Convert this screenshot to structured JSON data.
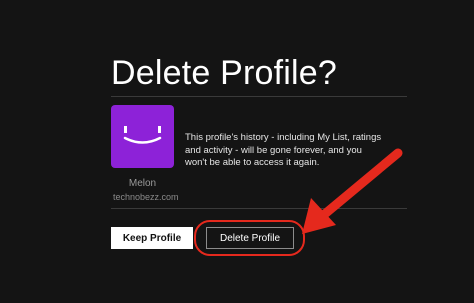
{
  "dialog": {
    "title": "Delete Profile?",
    "message": "This profile's history - including My List, ratings and activity - will be gone forever, and you won't be able to access it again.",
    "profile_name": "Melon"
  },
  "watermark": "technobezz.com",
  "buttons": {
    "keep_label": "Keep Profile",
    "delete_label": "Delete Profile"
  },
  "icons": {
    "avatar": "smiley-face-icon",
    "annotation": "red-arrow-icon"
  },
  "colors": {
    "background": "#141414",
    "avatar": "#8d22d8",
    "annotation": "#e5291d"
  }
}
